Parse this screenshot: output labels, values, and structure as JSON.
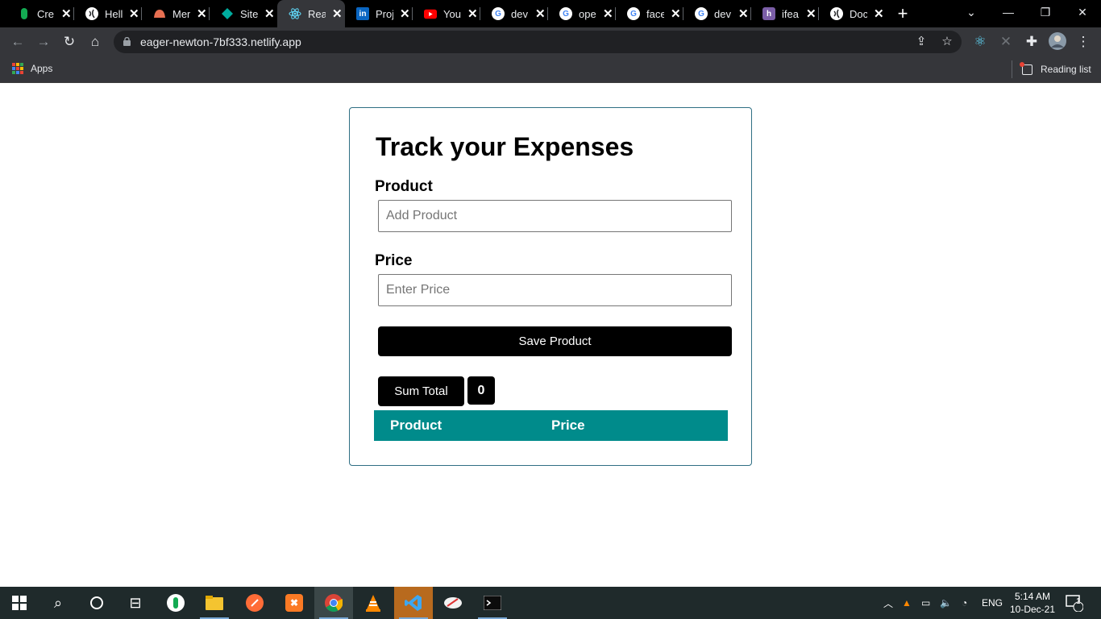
{
  "browser": {
    "tabs": [
      {
        "title": "Cre",
        "icon": "green-db-icon",
        "color": "#13aa52"
      },
      {
        "title": "Hell",
        "icon": "globe-icon",
        "color": "#ffffff"
      },
      {
        "title": "Mer",
        "icon": "mern-icon",
        "color": "#e76f51"
      },
      {
        "title": "Site",
        "icon": "netlify-icon",
        "color": "#00ad9f"
      },
      {
        "title": "Rea",
        "icon": "react-icon",
        "color": "#61dafb",
        "active": true
      },
      {
        "title": "Proj",
        "icon": "linkedin-icon",
        "color": "#0a66c2"
      },
      {
        "title": "You",
        "icon": "youtube-icon",
        "color": "#ff0000"
      },
      {
        "title": "dev",
        "icon": "google-icon",
        "color": "#4285f4"
      },
      {
        "title": "ope",
        "icon": "google-icon",
        "color": "#4285f4"
      },
      {
        "title": "face",
        "icon": "google-icon",
        "color": "#4285f4"
      },
      {
        "title": "dev",
        "icon": "google-icon",
        "color": "#4285f4"
      },
      {
        "title": "ifea",
        "icon": "h-letter-icon",
        "color": "#7b5ea7"
      },
      {
        "title": "Doc",
        "icon": "globe-icon",
        "color": "#ffffff"
      }
    ],
    "close_glyph": "✕",
    "new_tab_glyph": "+",
    "url": "eager-newton-7bf333.netlify.app",
    "bookmarks": {
      "apps_label": "Apps",
      "reading_list_label": "Reading list"
    }
  },
  "app": {
    "title": "Track your Expenses",
    "product_label": "Product",
    "product_placeholder": "Add Product",
    "price_label": "Price",
    "price_placeholder": "Enter Price",
    "save_button": "Save Product",
    "sum_button": "Sum Total",
    "sum_value": "0",
    "table_headers": [
      "Product",
      "Price"
    ],
    "accent_color": "#008b8b"
  },
  "taskbar": {
    "language": "ENG",
    "time": "5:14 AM",
    "date": "10-Dec-21",
    "notification_count": "1"
  }
}
